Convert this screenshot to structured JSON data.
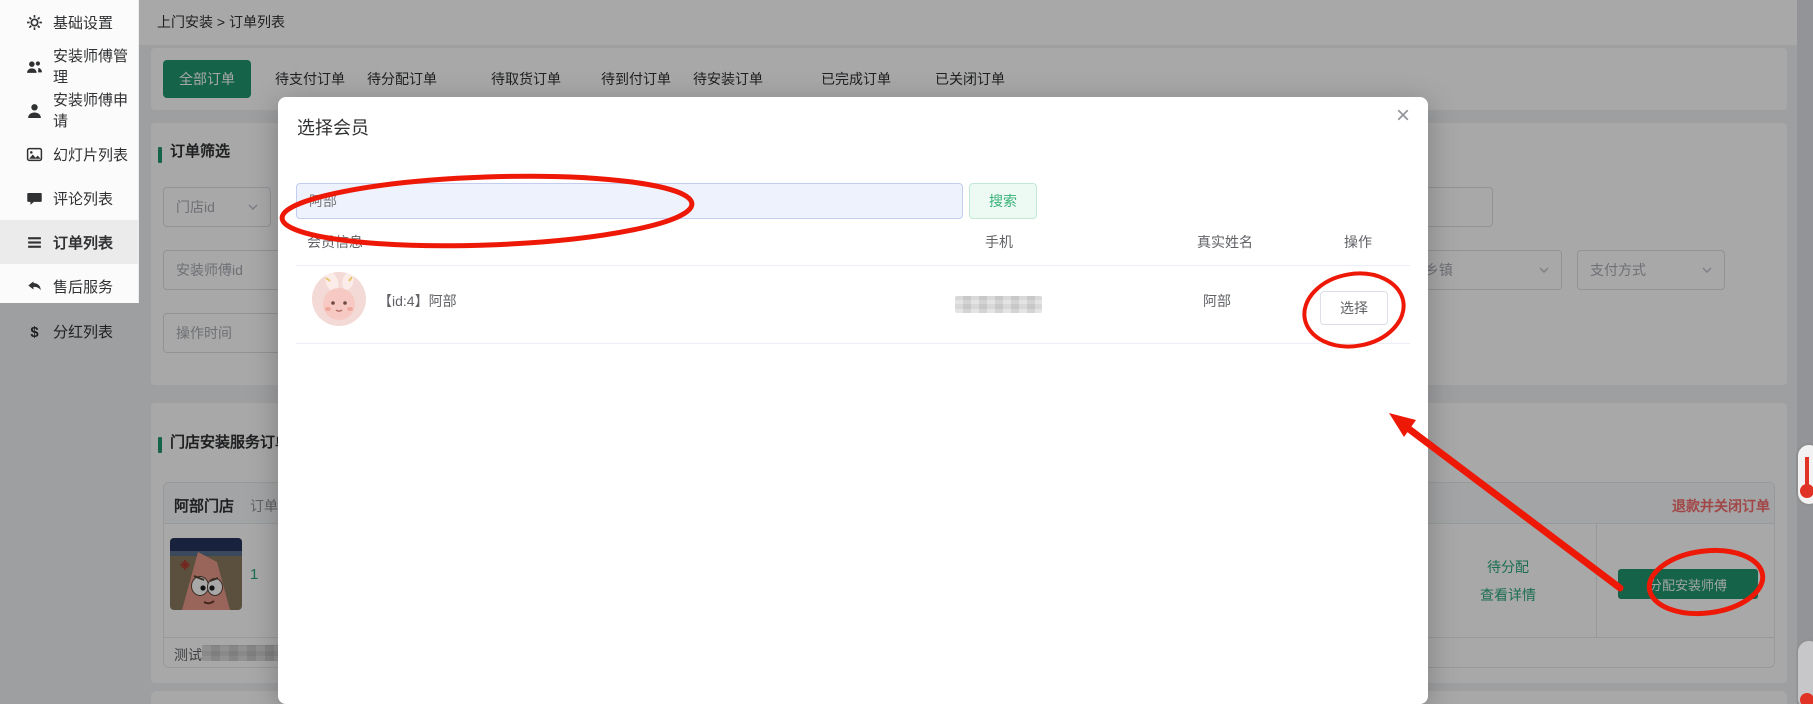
{
  "breadcrumb": {
    "path": "上门安装 > 订单列表"
  },
  "sidebar": {
    "items": [
      {
        "label": "基础设置",
        "icon": "gear-icon"
      },
      {
        "label": "安装师傅管理",
        "icon": "users-icon"
      },
      {
        "label": "安装师傅申请",
        "icon": "user-icon"
      },
      {
        "label": "幻灯片列表",
        "icon": "slide-image-icon"
      },
      {
        "label": "评论列表",
        "icon": "comment-icon"
      },
      {
        "label": "订单列表",
        "icon": "list-icon",
        "active": true
      },
      {
        "label": "售后服务",
        "icon": "reply-icon"
      },
      {
        "label": "分红列表",
        "icon": "dollar-icon"
      }
    ]
  },
  "tabs": {
    "items": [
      "全部订单",
      "待支付订单",
      "待分配订单",
      "待取货订单",
      "待到付订单",
      "待安装订单",
      "已完成订单",
      "已关闭订单"
    ]
  },
  "filter_card": {
    "title": "订单筛选",
    "store_id_placeholder": "门店id",
    "installer_id_placeholder": "安装师傅id",
    "operate_time_placeholder": "操作时间",
    "street_placeholder": "街道/乡镇",
    "payment_placeholder": "支付方式"
  },
  "order_card": {
    "title": "门店安装服务订单",
    "store_name": "阿部门店",
    "order_id_label": "订单ID:",
    "refund_close_label": "退款并关闭订单",
    "quantity": "1",
    "status": "待分配",
    "view_detail_label": "查看详情",
    "assign_button_label": "分配安装师傅",
    "footer_label": "测试"
  },
  "modal": {
    "title": "选择会员",
    "close_glyph": "×",
    "search_value": "阿部",
    "search_button_label": "搜索",
    "columns": [
      "会员信息",
      "手机",
      "真实姓名",
      "操作"
    ],
    "member": {
      "display_name": "【id:4】阿部",
      "real_name": "阿部",
      "select_button_label": "选择"
    }
  },
  "colors": {
    "accent_green": "#219670",
    "light_green_button_text": "#38b178",
    "danger_red": "#f56c6c",
    "annotation_red": "#ee1807",
    "search_input_bg": "#eef2fd"
  }
}
